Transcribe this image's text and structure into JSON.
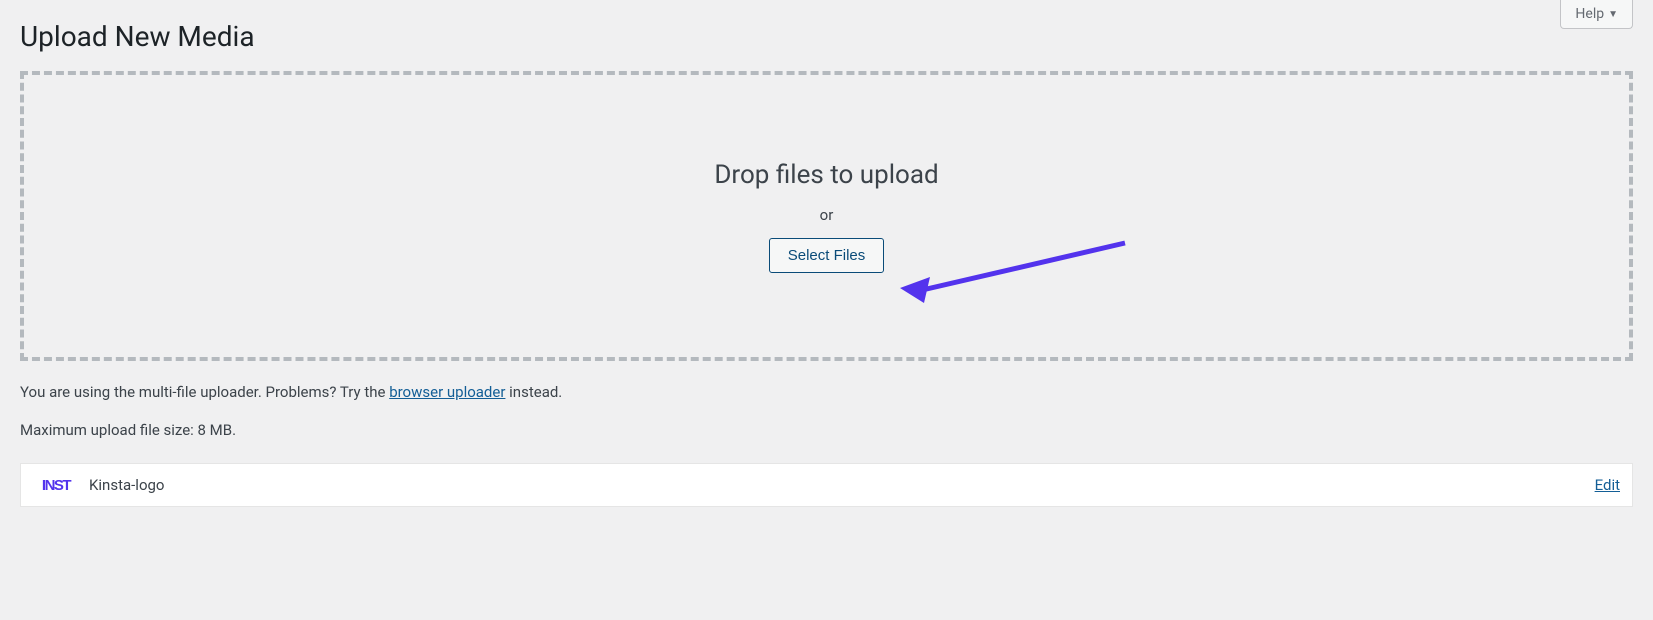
{
  "header": {
    "page_title": "Upload New Media",
    "help_label": "Help"
  },
  "drop_zone": {
    "title": "Drop files to upload",
    "or_text": "or",
    "select_button": "Select Files"
  },
  "info": {
    "prefix": "You are using the multi-file uploader. Problems? Try the ",
    "link_text": "browser uploader",
    "suffix": " instead."
  },
  "max_size": "Maximum upload file size: 8 MB.",
  "uploaded": {
    "thumb_text": "INST",
    "filename": "Kinsta-logo",
    "edit_label": "Edit"
  }
}
